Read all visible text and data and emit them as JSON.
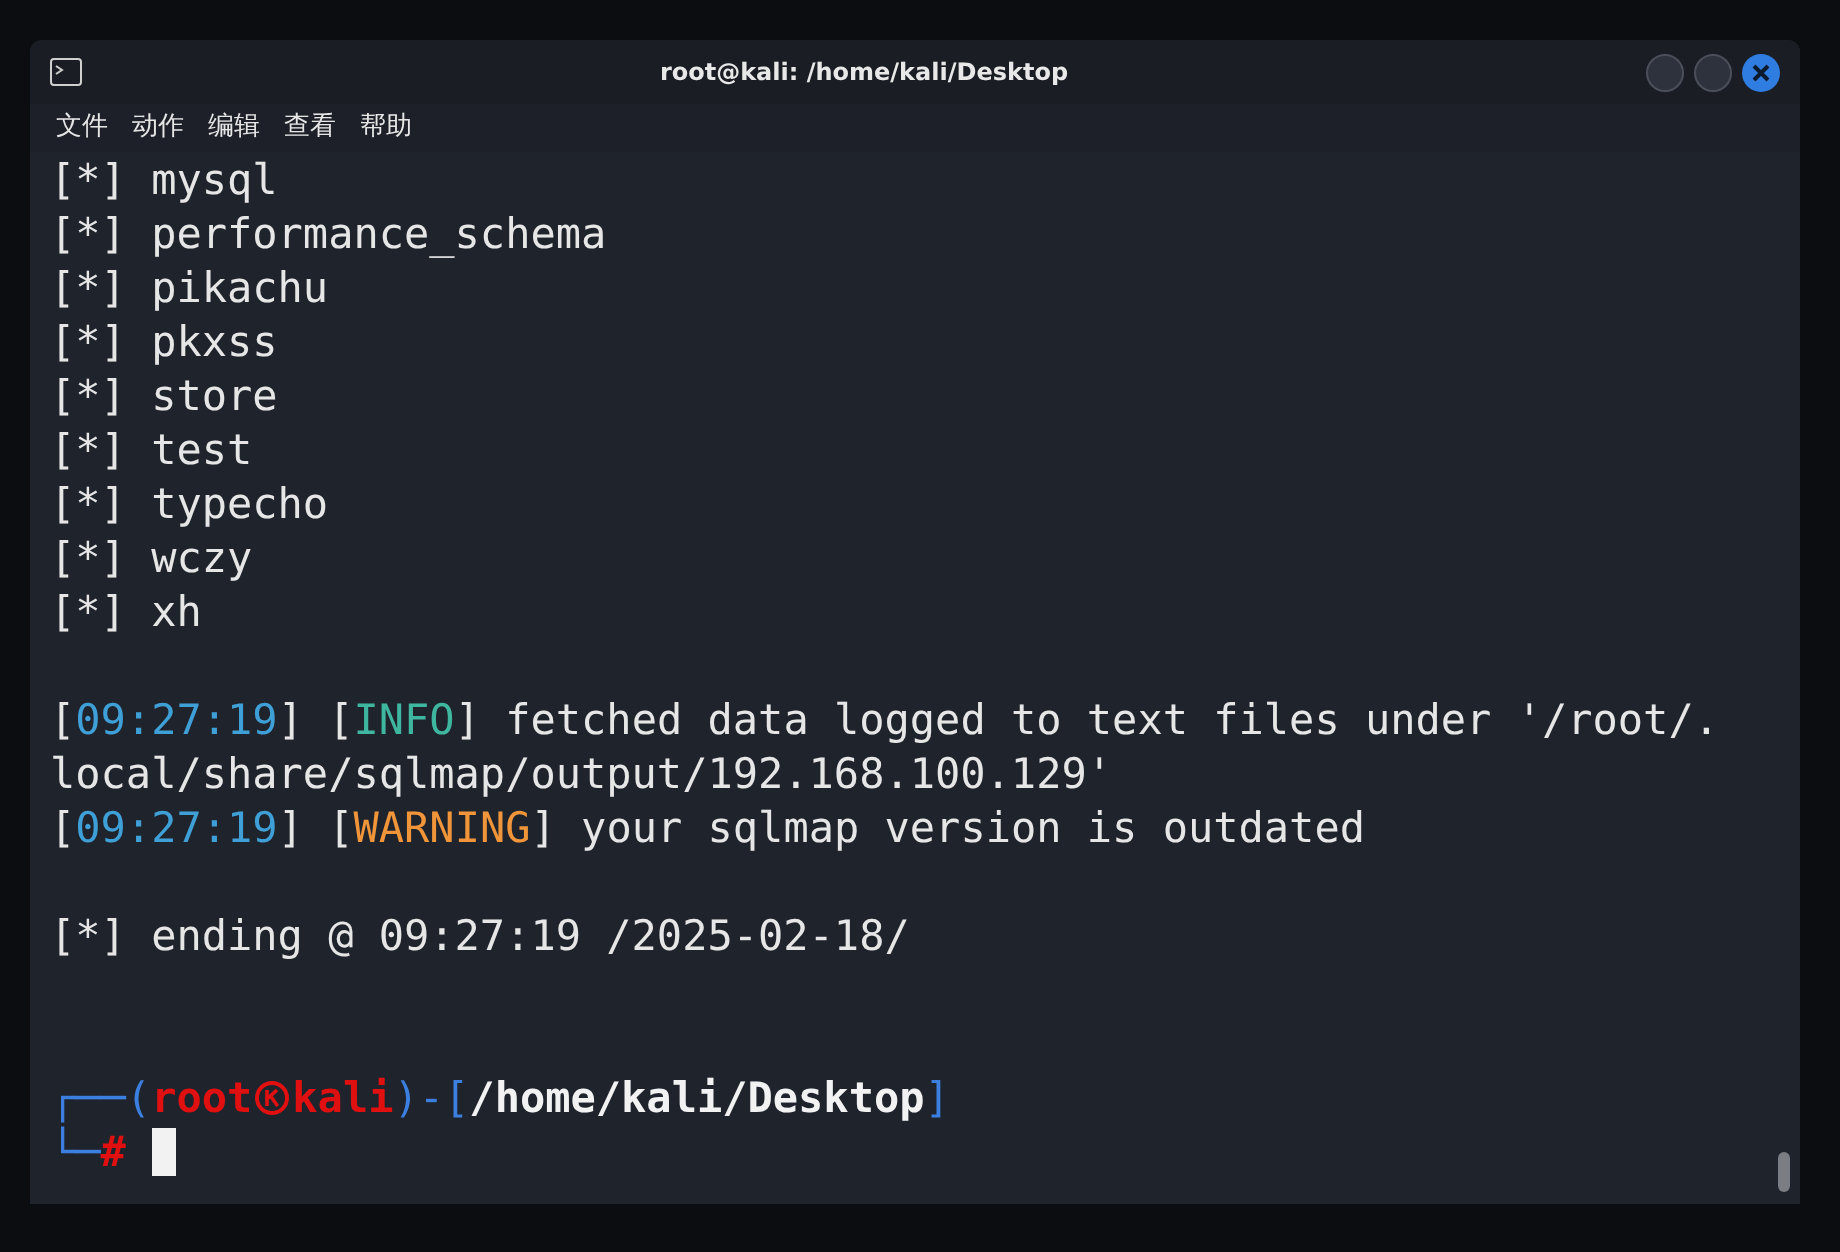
{
  "window": {
    "title": "root@kali: /home/kali/Desktop"
  },
  "menu": [
    {
      "label": "文件"
    },
    {
      "label": "动作"
    },
    {
      "label": "编辑"
    },
    {
      "label": "查看"
    },
    {
      "label": "帮助"
    }
  ],
  "terminal": {
    "lines": [
      {
        "kind": "text",
        "segments": [
          {
            "kind": "plain",
            "text": "[*] mysql"
          }
        ]
      },
      {
        "kind": "text",
        "segments": [
          {
            "kind": "plain",
            "text": "[*] performance_schema"
          }
        ]
      },
      {
        "kind": "text",
        "segments": [
          {
            "kind": "plain",
            "text": "[*] pikachu"
          }
        ]
      },
      {
        "kind": "text",
        "segments": [
          {
            "kind": "plain",
            "text": "[*] pkxss"
          }
        ]
      },
      {
        "kind": "text",
        "segments": [
          {
            "kind": "plain",
            "text": "[*] store"
          }
        ]
      },
      {
        "kind": "text",
        "segments": [
          {
            "kind": "plain",
            "text": "[*] test"
          }
        ]
      },
      {
        "kind": "text",
        "segments": [
          {
            "kind": "plain",
            "text": "[*] typecho"
          }
        ]
      },
      {
        "kind": "text",
        "segments": [
          {
            "kind": "plain",
            "text": "[*] wczy"
          }
        ]
      },
      {
        "kind": "text",
        "segments": [
          {
            "kind": "plain",
            "text": "[*] xh"
          }
        ]
      },
      {
        "kind": "blank"
      },
      {
        "kind": "text",
        "segments": [
          {
            "kind": "plain",
            "text": "["
          },
          {
            "kind": "time",
            "text": "09:27:19"
          },
          {
            "kind": "plain",
            "text": "] ["
          },
          {
            "kind": "info",
            "text": "INFO"
          },
          {
            "kind": "plain",
            "text": "] fetched data logged to text files under '/root/."
          }
        ]
      },
      {
        "kind": "text",
        "segments": [
          {
            "kind": "plain",
            "text": "local/share/sqlmap/output/192.168.100.129'"
          }
        ]
      },
      {
        "kind": "text",
        "segments": [
          {
            "kind": "plain",
            "text": "["
          },
          {
            "kind": "time",
            "text": "09:27:19"
          },
          {
            "kind": "plain",
            "text": "] ["
          },
          {
            "kind": "warning",
            "text": "WARNING"
          },
          {
            "kind": "plain",
            "text": "] your sqlmap version is outdated"
          }
        ]
      },
      {
        "kind": "blank"
      },
      {
        "kind": "text",
        "segments": [
          {
            "kind": "plain",
            "text": "[*] ending @ 09:27:19 /2025-02-18/"
          }
        ]
      },
      {
        "kind": "blank"
      },
      {
        "kind": "blank"
      },
      {
        "kind": "text",
        "segments": [
          {
            "kind": "frame",
            "text": "┌──("
          },
          {
            "kind": "user",
            "text": "root"
          },
          {
            "kind": "symbol"
          },
          {
            "kind": "user",
            "text": "kali"
          },
          {
            "kind": "frame",
            "text": ")-["
          },
          {
            "kind": "path",
            "text": "/home/kali/Desktop"
          },
          {
            "kind": "frame",
            "text": "]"
          }
        ]
      },
      {
        "kind": "text",
        "segments": [
          {
            "kind": "frame",
            "text": "└─"
          },
          {
            "kind": "user",
            "text": "#"
          },
          {
            "kind": "cursor"
          }
        ]
      }
    ]
  }
}
